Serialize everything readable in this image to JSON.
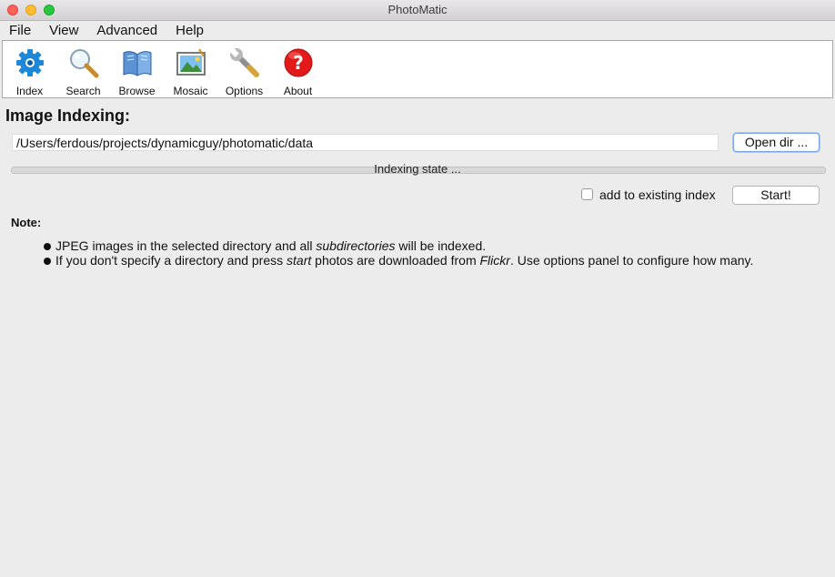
{
  "window": {
    "title": "PhotoMatic"
  },
  "menu": [
    "File",
    "View",
    "Advanced",
    "Help"
  ],
  "toolbar": [
    {
      "label": "Index",
      "icon": "gear-icon"
    },
    {
      "label": "Search",
      "icon": "magnifier-icon"
    },
    {
      "label": "Browse",
      "icon": "book-icon"
    },
    {
      "label": "Mosaic",
      "icon": "picture-icon"
    },
    {
      "label": "Options",
      "icon": "wrench-icon"
    },
    {
      "label": "About",
      "icon": "help-icon"
    }
  ],
  "indexing": {
    "heading": "Image Indexing:",
    "path": "/Users/ferdous/projects/dynamicguy/photomatic/data",
    "open_dir_label": "Open dir ...",
    "state_text": "Indexing state ...",
    "progress": 0,
    "add_existing_label": "add to existing index",
    "add_existing_checked": false,
    "start_label": "Start!"
  },
  "note": {
    "title": "Note:",
    "items": [
      {
        "parts": [
          {
            "text": "JPEG images in the selected directory and all ",
            "italic": false
          },
          {
            "text": "subdirectories",
            "italic": true
          },
          {
            "text": " will be indexed.",
            "italic": false
          }
        ]
      },
      {
        "parts": [
          {
            "text": "If you don't specify a directory and press ",
            "italic": false
          },
          {
            "text": "start",
            "italic": true
          },
          {
            "text": " photos are downloaded from ",
            "italic": false
          },
          {
            "text": "Flickr",
            "italic": true
          },
          {
            "text": ". Use options panel to configure how many.",
            "italic": false
          }
        ]
      }
    ]
  },
  "colors": {
    "close": "#fe5f57",
    "minimize": "#febc2e",
    "maximize": "#28c840",
    "gear": "#1e88d8",
    "help": "#e21a1a"
  }
}
